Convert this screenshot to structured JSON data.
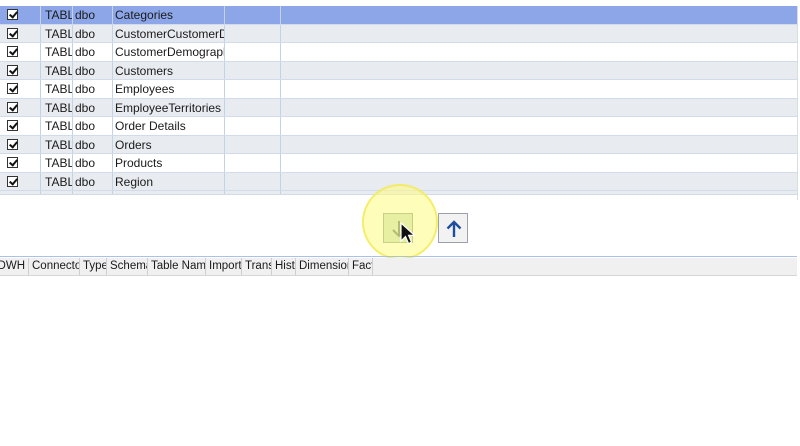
{
  "top_grid": {
    "rows": [
      {
        "checked": true,
        "type": "TABLE",
        "schema": "dbo",
        "name": "Categories",
        "selected": true
      },
      {
        "checked": true,
        "type": "TABLE",
        "schema": "dbo",
        "name": "CustomerCustomerDemo",
        "selected": false
      },
      {
        "checked": true,
        "type": "TABLE",
        "schema": "dbo",
        "name": "CustomerDemographics",
        "selected": false
      },
      {
        "checked": true,
        "type": "TABLE",
        "schema": "dbo",
        "name": "Customers",
        "selected": false
      },
      {
        "checked": true,
        "type": "TABLE",
        "schema": "dbo",
        "name": "Employees",
        "selected": false
      },
      {
        "checked": true,
        "type": "TABLE",
        "schema": "dbo",
        "name": "EmployeeTerritories",
        "selected": false
      },
      {
        "checked": true,
        "type": "TABLE",
        "schema": "dbo",
        "name": "Order Details",
        "selected": false
      },
      {
        "checked": true,
        "type": "TABLE",
        "schema": "dbo",
        "name": "Orders",
        "selected": false
      },
      {
        "checked": true,
        "type": "TABLE",
        "schema": "dbo",
        "name": "Products",
        "selected": false
      },
      {
        "checked": true,
        "type": "TABLE",
        "schema": "dbo",
        "name": "Region",
        "selected": false
      }
    ]
  },
  "buttons": {
    "move_down_icon": "arrow-down-icon",
    "move_up_icon": "arrow-up-icon"
  },
  "bottom_grid": {
    "columns": [
      "DWH",
      "Connector",
      "Type",
      "Schema",
      "Table Name",
      "Import",
      "Trans",
      "Hist",
      "Dimension",
      "Fact"
    ]
  },
  "colors": {
    "selected_row": "#8ca6e8",
    "alt_row": "#e8ebf0",
    "down_button": "#c9dfcc",
    "up_arrow": "#1f4f9c",
    "highlight": "#fffc82"
  }
}
